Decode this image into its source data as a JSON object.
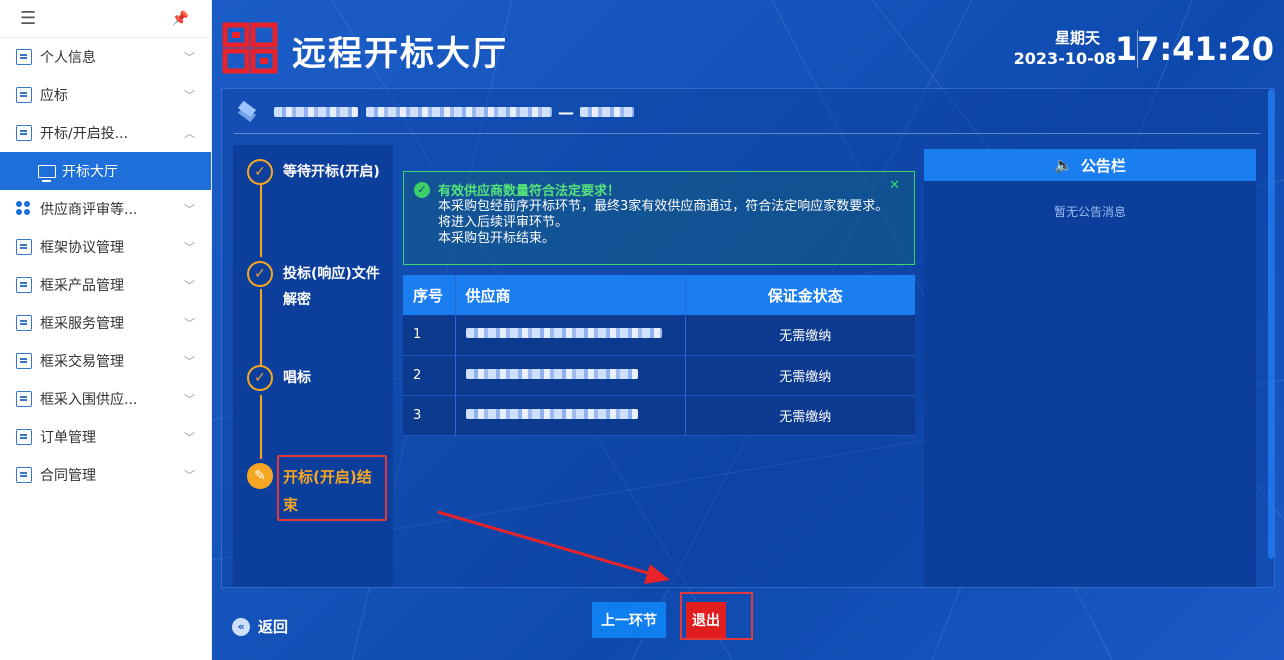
{
  "sidebar": {
    "items": [
      {
        "label": "个人信息",
        "chevron": "﹀"
      },
      {
        "label": "应标",
        "chevron": "﹀"
      },
      {
        "label": "开标/开启投...",
        "chevron": "︿"
      },
      {
        "label": "开标大厅"
      },
      {
        "label": "供应商评审等...",
        "chevron": "﹀"
      },
      {
        "label": "框架协议管理",
        "chevron": "﹀"
      },
      {
        "label": "框采产品管理",
        "chevron": "﹀"
      },
      {
        "label": "框采服务管理",
        "chevron": "﹀"
      },
      {
        "label": "框采交易管理",
        "chevron": "﹀"
      },
      {
        "label": "框采入围供应...",
        "chevron": "﹀"
      },
      {
        "label": "订单管理",
        "chevron": "﹀"
      },
      {
        "label": "合同管理",
        "chevron": "﹀"
      }
    ]
  },
  "header": {
    "title": "远程开标大厅",
    "weekday": "星期天",
    "date": "2023-10-08",
    "time": "17:41:20"
  },
  "steps": [
    {
      "label": "等待开标(开启)"
    },
    {
      "label": "投标(响应)文件解密"
    },
    {
      "label": "唱标"
    },
    {
      "label": "开标(开启)结束"
    }
  ],
  "alert": {
    "title": "有效供应商数量符合法定要求！",
    "lines": [
      "本采购包经前序开标环节，最终3家有效供应商通过，符合法定响应家数要求。",
      "将进入后续评审环节。",
      "本采购包开标结束。"
    ]
  },
  "table": {
    "headers": [
      "序号",
      "供应商",
      "保证金状态"
    ],
    "rows": [
      {
        "no": "1",
        "status": "无需缴纳"
      },
      {
        "no": "2",
        "status": "无需缴纳"
      },
      {
        "no": "3",
        "status": "无需缴纳"
      }
    ]
  },
  "notice": {
    "title": "公告栏",
    "empty": "暂无公告消息"
  },
  "footer": {
    "back": "返回",
    "prev_button": "上一环节",
    "exit_button": "退出"
  },
  "colors": {
    "accent": "#1e6fd9",
    "step_done": "#f6a623",
    "success": "#3dd46a",
    "exit": "#e11e1e"
  }
}
